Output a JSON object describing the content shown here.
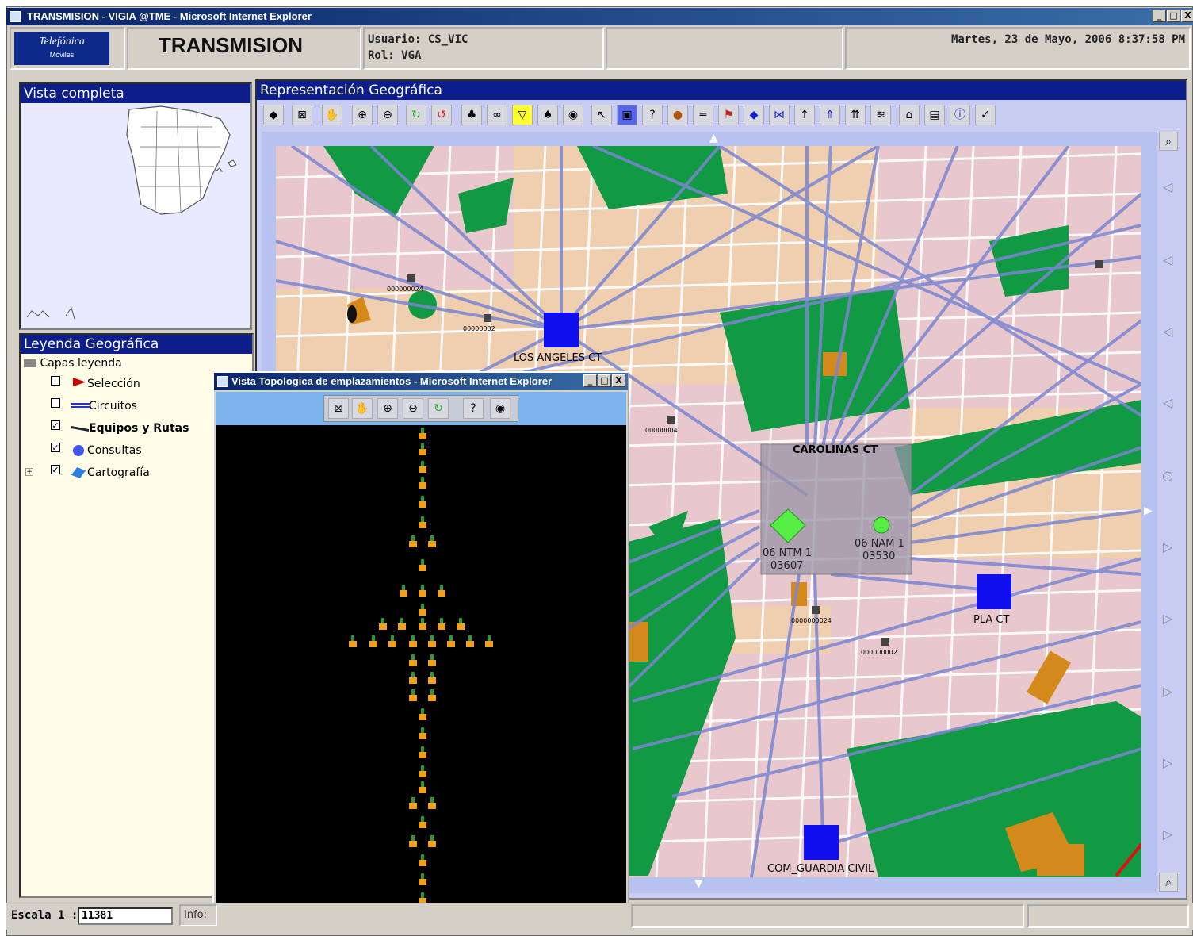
{
  "window": {
    "title": "TRANSMISION - VIGIA @TME - Microsoft Internet Explorer",
    "min": "_",
    "max": "□",
    "close": "X"
  },
  "header": {
    "logo_line1": "Telefónica",
    "logo_line2": "Móviles",
    "app_title": "TRANSMISION",
    "user_line": "Usuario: CS_VIC",
    "role_line": "Rol: VGA",
    "datetime": "Martes, 23 de Mayo, 2006 8:37:58 PM"
  },
  "overview": {
    "title": "Vista completa"
  },
  "legend": {
    "title": "Leyenda Geográfica",
    "root": "Capas leyenda",
    "items": [
      {
        "label": "Selección",
        "checked": false,
        "icon": "red-flag-icon"
      },
      {
        "label": "Circuitos",
        "checked": false,
        "icon": "circuit-lines-icon"
      },
      {
        "label": "Equipos y Rutas",
        "checked": true,
        "icon": "routes-icon"
      },
      {
        "label": "Consultas",
        "checked": true,
        "icon": "query-circle-icon"
      },
      {
        "label": "Cartografía",
        "checked": true,
        "icon": "cartography-icon"
      }
    ]
  },
  "map": {
    "title": "Representación Geográfica",
    "labels": {
      "site_angel": "LOS ANGELES CT",
      "site_carolinas": "CAROLINAS CT",
      "ntm": "06 NTM 1",
      "ntm_code": "03607",
      "nam": "06 NAM 1",
      "nam_code": "03530",
      "site_pla": "PLA CT",
      "site_com": "COM_GUARDIA CIVIL",
      "small1": "000000024",
      "small2": "00000002",
      "small3": "00000004",
      "small4": "0000000024",
      "small5": "000000002"
    }
  },
  "subwindow": {
    "title": "Vista Topologica de emplazamientos - Microsoft Internet Explorer",
    "min": "_",
    "max": "□",
    "close": "X"
  },
  "status": {
    "scale_label": "Escala 1 :",
    "scale_value": "11381",
    "info_label": "Info:"
  }
}
